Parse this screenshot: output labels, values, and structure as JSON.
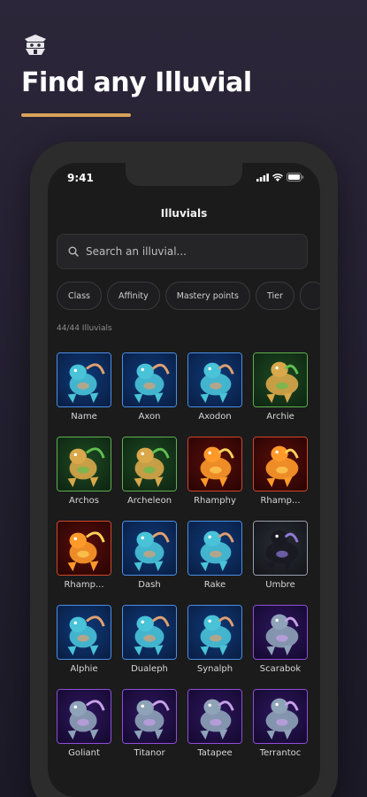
{
  "headline": "Find any Illuvial",
  "colors": {
    "accent": "#d9a35a",
    "water": "#2f7fd0",
    "earth": "#3fa34d",
    "fire": "#b8361e",
    "air": "#8a8f9c",
    "nature": "#7a3fc0"
  },
  "phone": {
    "time": "9:41",
    "title": "Illuvials",
    "search_placeholder": "Search an illuvial...",
    "filters": [
      "Class",
      "Affinity",
      "Mastery points",
      "Tier"
    ],
    "count_label": "44/44 Illuvials",
    "illuvials": [
      {
        "name": "Name",
        "affinity": "water"
      },
      {
        "name": "Axon",
        "affinity": "water"
      },
      {
        "name": "Axodon",
        "affinity": "water"
      },
      {
        "name": "Archie",
        "affinity": "earth"
      },
      {
        "name": "Archos",
        "affinity": "earth"
      },
      {
        "name": "Archeleon",
        "affinity": "earth"
      },
      {
        "name": "Rhamphy",
        "affinity": "fire"
      },
      {
        "name": "Rhamp...",
        "affinity": "fire"
      },
      {
        "name": "Rhamp...",
        "affinity": "fire"
      },
      {
        "name": "Dash",
        "affinity": "water"
      },
      {
        "name": "Rake",
        "affinity": "water"
      },
      {
        "name": "Umbre",
        "affinity": "air"
      },
      {
        "name": "Alphie",
        "affinity": "water"
      },
      {
        "name": "Dualeph",
        "affinity": "water"
      },
      {
        "name": "Synalph",
        "affinity": "water"
      },
      {
        "name": "Scarabok",
        "affinity": "nature"
      },
      {
        "name": "Goliant",
        "affinity": "nature"
      },
      {
        "name": "Titanor",
        "affinity": "nature"
      },
      {
        "name": "Tatapee",
        "affinity": "nature"
      },
      {
        "name": "Terrantoc",
        "affinity": "nature"
      }
    ]
  }
}
